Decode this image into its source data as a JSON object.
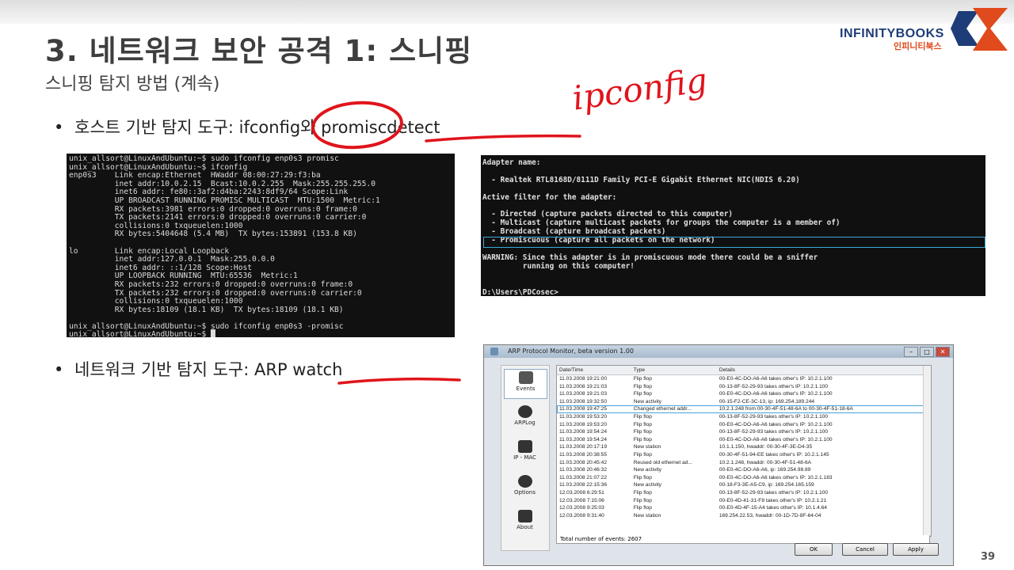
{
  "slide": {
    "title": "3. 네트워크 보안 공격 1: 스니핑",
    "subtitle": "스니핑 탐지 방법 (계속)",
    "page_number": "39",
    "logo": {
      "name": "INFINITYBOOKS",
      "korean": "인피니티북스"
    },
    "bullets": [
      {
        "dot": "•",
        "prefix": "호스트 기반 탐지 도구: ",
        "tool1": "ifconfig",
        "connector": "와 ",
        "tool2": "promiscdetect"
      },
      {
        "dot": "•",
        "prefix": "네트워크 기반 탐지 도구: ",
        "tool1": "ARP watch"
      }
    ],
    "handwriting": "ipconfig",
    "accent_color": "#e0141c"
  },
  "linux_terminal": {
    "lines": [
      "unix_allsort@LinuxAndUbuntu:~$ sudo ifconfig enp0s3 promisc",
      "unix_allsort@LinuxAndUbuntu:~$ ifconfig",
      "enp0s3    Link encap:Ethernet  HWaddr 08:00:27:29:f3:ba",
      "          inet addr:10.0.2.15  Bcast:10.0.2.255  Mask:255.255.255.0",
      "          inet6 addr: fe80::3af2:d4ba:2243:8df9/64 Scope:Link",
      "          UP BROADCAST RUNNING PROMISC MULTICAST  MTU:1500  Metric:1",
      "          RX packets:3981 errors:0 dropped:0 overruns:0 frame:0",
      "          TX packets:2141 errors:0 dropped:0 overruns:0 carrier:0",
      "          collisions:0 txqueuelen:1000",
      "          RX bytes:5404648 (5.4 MB)  TX bytes:153891 (153.8 KB)",
      "",
      "lo        Link encap:Local Loopback",
      "          inet addr:127.0.0.1  Mask:255.0.0.0",
      "          inet6 addr: ::1/128 Scope:Host",
      "          UP LOOPBACK RUNNING  MTU:65536  Metric:1",
      "          RX packets:232 errors:0 dropped:0 overruns:0 frame:0",
      "          TX packets:232 errors:0 dropped:0 overruns:0 carrier:0",
      "          collisions:0 txqueuelen:1000",
      "          RX bytes:18109 (18.1 KB)  TX bytes:18109 (18.1 KB)",
      "",
      "unix_allsort@LinuxAndUbuntu:~$ sudo ifconfig enp0s3 -promisc",
      "unix_allsort@LinuxAndUbuntu:~$ █"
    ]
  },
  "windows_cmd": {
    "lines": [
      "Adapter name:",
      "",
      "  - Realtek RTL8168D/8111D Family PCI-E Gigabit Ethernet NIC(NDIS 6.20)",
      "",
      "Active filter for the adapter:",
      "",
      "  - Directed (capture packets directed to this computer)",
      "  - Multicast (capture multicast packets for groups the computer is a member of)",
      "  - Broadcast (capture broadcast packets)",
      "  - Promiscuous (capture all packets on the network)",
      "",
      "WARNING: Since this adapter is in promiscuous mode there could be a sniffer",
      "         running on this computer!",
      "",
      "",
      "D:\\Users\\PDCosec>"
    ]
  },
  "arp_window": {
    "title": "ARP Protocol Monitor, beta version 1.00",
    "nav": [
      "Events",
      "ARPLog",
      "IP - MAC",
      "Options",
      "About"
    ],
    "columns": [
      "Date/Time",
      "Type",
      "Details"
    ],
    "rows": [
      [
        "11.03.2008 19:21:00",
        "Flip flop",
        "00-E0-4C-DO-A6-A6 takes other's IP: 10.2.1.100"
      ],
      [
        "11.03.2008 19:21:03",
        "Flip flop",
        "00-13-8F-52-29-93 takes other's IP: 10.2.1.100"
      ],
      [
        "11.03.2008 19:21:03",
        "Flip flop",
        "00-E0-4C-DO-A6-A6 takes other's IP: 10.2.1.100"
      ],
      [
        "11.03.2008 19:32:50",
        "New activity",
        "00-15-F2-CE-3C-13, ip: 169.254.189.244"
      ],
      [
        "11.03.2008 19:47:25",
        "Changed ethernet addr...",
        "10.2.1.248 from 00-30-4F-51-48-6A to 00-30-4F-51-18-6A"
      ],
      [
        "11.03.2008 19:53:20",
        "Flip flop",
        "00-13-8F-52-29-93 takes other's IP: 10.2.1.100"
      ],
      [
        "11.03.2008 19:53:20",
        "Flip flop",
        "00-E0-4C-DO-A6-A6 takes other's IP: 10.2.1.100"
      ],
      [
        "11.03.2008 19:54:24",
        "Flip flop",
        "00-13-8F-52-29-93 takes other's IP: 10.2.1.100"
      ],
      [
        "11.03.2008 19:54:24",
        "Flip flop",
        "00-E0-4C-DO-A6-A6 takes other's IP: 10.2.1.100"
      ],
      [
        "11.03.2008 20:17:19",
        "New station",
        "10.1.1.150, hwaddr: 00-30-4F-3E-D4-35"
      ],
      [
        "11.03.2008 20:38:55",
        "Flip flop",
        "00-30-4F-51-94-EE takes other's IP: 10.2.1.145"
      ],
      [
        "11.03.2008 20:45:42",
        "Reused old ethernet ad...",
        "10.2.1.248, hwaddr: 00-30-4F-51-48-6A"
      ],
      [
        "11.03.2008 20:46:32",
        "New activity",
        "00-E0-4C-DO-A6-A6, ip: 169.254.98.89"
      ],
      [
        "11.03.2008 21:07:22",
        "Flip flop",
        "00-E0-4C-DO-A6-A6 takes other's IP: 10.2.1.183"
      ],
      [
        "11.03.2008 22:15:36",
        "New activity",
        "00-18-F3-3E-A5-C9, ip: 169.254.165.159"
      ],
      [
        "12.03.2008 6:29:51",
        "Flip flop",
        "00-13-8F-52-29-93 takes other's IP: 10.2.1.100"
      ],
      [
        "12.03.2008 7:15:06",
        "Flip flop",
        "00-E0-4D-41-31-F8 takes other's IP: 10.2.1.21"
      ],
      [
        "12.03.2008 9:25:03",
        "Flip flop",
        "00-E0-4D-4F-15-A4 takes other's IP: 10.1.4.64"
      ],
      [
        "12.03.2008 9:31:40",
        "New station",
        "169.254.22.53, hwaddr: 00-1D-7D-8F-64-04"
      ]
    ],
    "selected_row_index": 4,
    "footer": "Total number of events: 2607",
    "buttons": {
      "ok": "OK",
      "cancel": "Cancel",
      "apply": "Apply"
    }
  }
}
